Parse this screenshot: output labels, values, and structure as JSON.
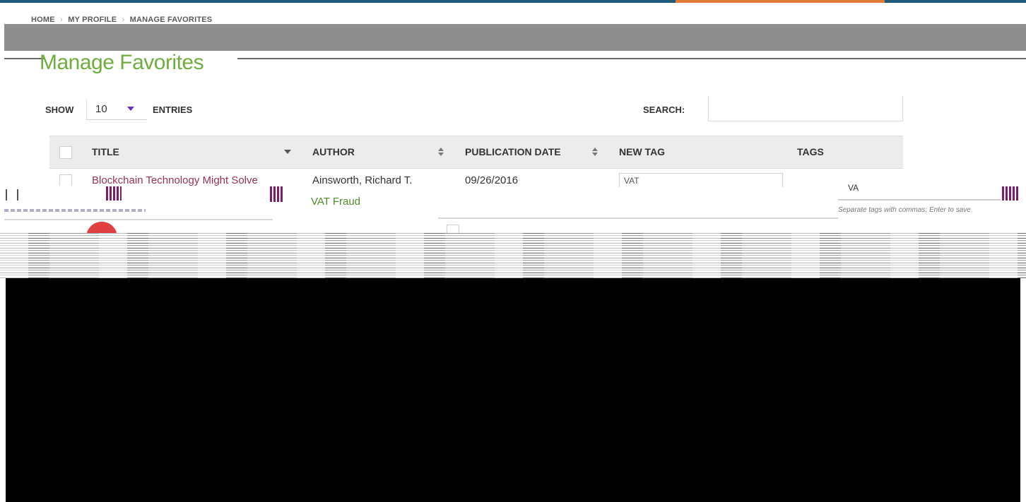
{
  "breadcrumb": {
    "home": "HOME",
    "profile": "MY PROFILE",
    "current": "MANAGE FAVORITES",
    "separator": "›"
  },
  "page": {
    "title": "Manage Favorites"
  },
  "controls": {
    "show_label": "SHOW",
    "entries_value": "10",
    "entries_label": "ENTRIES",
    "search_label": "SEARCH:",
    "search_value": ""
  },
  "table": {
    "headers": {
      "title": "TITLE",
      "author": "AUTHOR",
      "publication_date": "PUBLICATION DATE",
      "new_tag": "NEW TAG",
      "tags": "TAGS"
    },
    "rows": [
      {
        "title": "Blockchain Technology Might Solve",
        "author": "Ainsworth, Richard T.",
        "publication_date": "09/26/2016",
        "new_tag_value": "VAT",
        "tag_value": "VA",
        "tag_pill": "VAT Fraud",
        "tag_hint": "Separate tags with commas; Enter to save"
      }
    ]
  },
  "colors": {
    "accent_bar": "#1f5a7a",
    "accent_orange": "#e07b39",
    "title_green": "#6fae3e",
    "link_maroon": "#9c2f5a",
    "caret_purple": "#6b2fc7"
  }
}
